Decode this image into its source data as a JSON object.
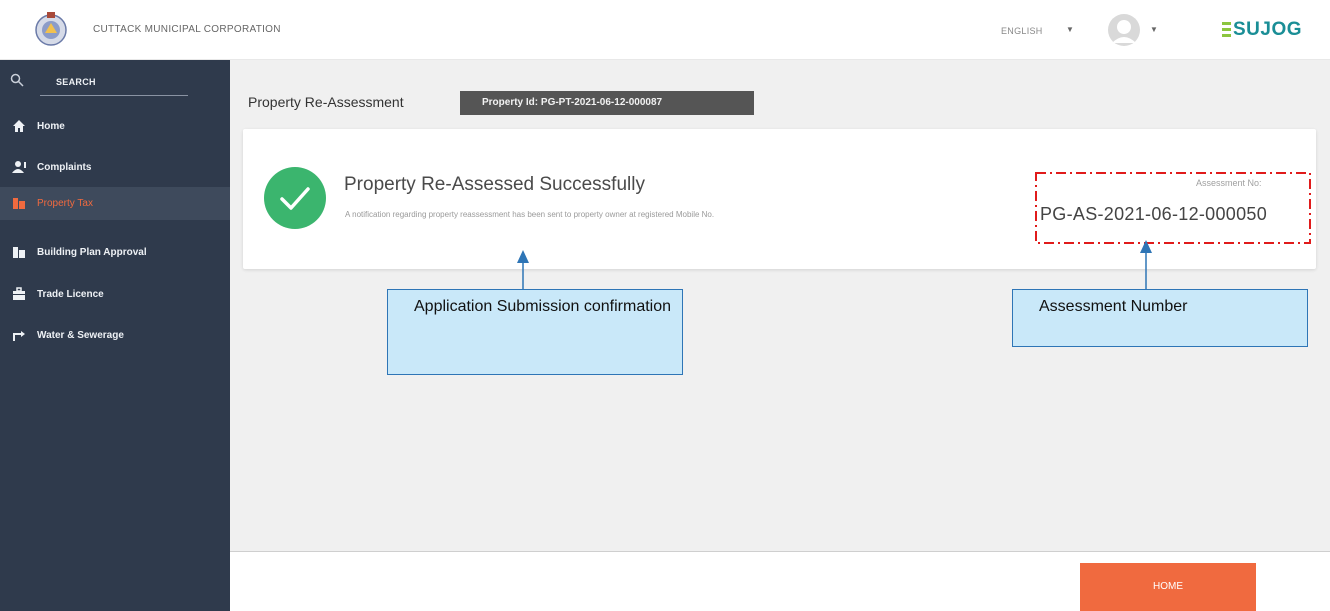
{
  "header": {
    "corporation": "CUTTACK MUNICIPAL CORPORATION",
    "language": "ENGLISH",
    "brand": "SUJOG"
  },
  "sidebar": {
    "search_label": "SEARCH",
    "items": [
      {
        "label": "Home",
        "icon": "home-icon"
      },
      {
        "label": "Complaints",
        "icon": "complaints-icon"
      },
      {
        "label": "Property Tax",
        "icon": "property-tax-icon",
        "active": true
      },
      {
        "label": "Building Plan Approval",
        "icon": "building-icon"
      },
      {
        "label": "Trade Licence",
        "icon": "briefcase-icon"
      },
      {
        "label": "Water & Sewerage",
        "icon": "tap-icon"
      }
    ]
  },
  "main": {
    "title": "Property Re-Assessment",
    "property_id": "Property Id: PG-PT-2021-06-12-000087",
    "success_title": "Property Re-Assessed Successfully",
    "notification": "A notification regarding property reassessment has been sent to property owner at registered Mobile No.",
    "assessment_label": "Assessment No:",
    "assessment_number": "PG-AS-2021-06-12-000050"
  },
  "footer": {
    "home_button": "HOME"
  },
  "annotations": {
    "submission": "Application Submission confirmation",
    "assessment": "Assessment Number"
  },
  "colors": {
    "sidebar_bg": "#2f3a4c",
    "accent": "#f06a3f",
    "success": "#3bb56e",
    "brand": "#1a8e96",
    "callout_bg": "#c9e8f9",
    "callout_border": "#2e75b6",
    "highlight_dash": "#e01b1b"
  }
}
